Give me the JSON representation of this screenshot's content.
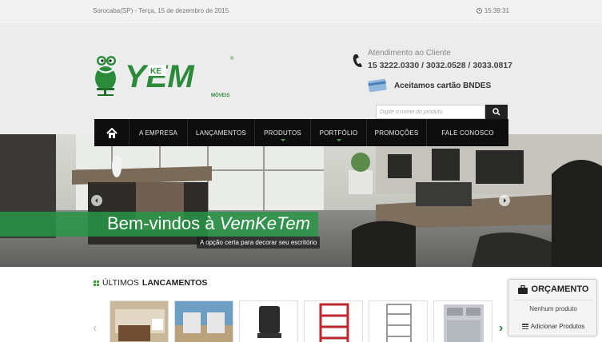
{
  "topbar": {
    "location_date": "Sorocaba(SP) - Terça, 15 de dezembro de 2015",
    "time": "15:39:31"
  },
  "brand": {
    "name": "YEM",
    "ke": "KE",
    "subtitle": "MÓVEIS",
    "colors": {
      "green": "#2c8b3a",
      "light_green": "#3aa142"
    }
  },
  "contact": {
    "label": "Atendimento ao Cliente",
    "phones": "15 3222.0330 / 3032.0528 / 3033.0817",
    "card_label": "Aceitamos cartão BNDES"
  },
  "search": {
    "placeholder": "Digite o nome do produto"
  },
  "nav": {
    "items": [
      {
        "label": "A EMPRESA"
      },
      {
        "label": "LANÇAMENTOS"
      },
      {
        "label": "PRODUTOS"
      },
      {
        "label": "PORTFÓLIO"
      },
      {
        "label": "PROMOÇÕES"
      },
      {
        "label": "FALE CONOSCO"
      }
    ]
  },
  "hero": {
    "title_prefix": "Bem-vindos à ",
    "title_brand": "VemKeTem",
    "subtitle": "A opção certa para decorar seu escritório"
  },
  "section": {
    "title_light": "ÚLTIMOS ",
    "title_bold": "LANCAMENTOS"
  },
  "quote": {
    "title": "ORÇAMENTO",
    "empty": "Nenhum produto",
    "add": "Adicionar Produtos"
  },
  "icons": [
    "clock-icon",
    "phone-icon",
    "card-icon",
    "search-icon",
    "home-icon",
    "grid-icon",
    "briefcase-icon",
    "list-icon",
    "chevron-left-icon",
    "chevron-right-icon"
  ]
}
